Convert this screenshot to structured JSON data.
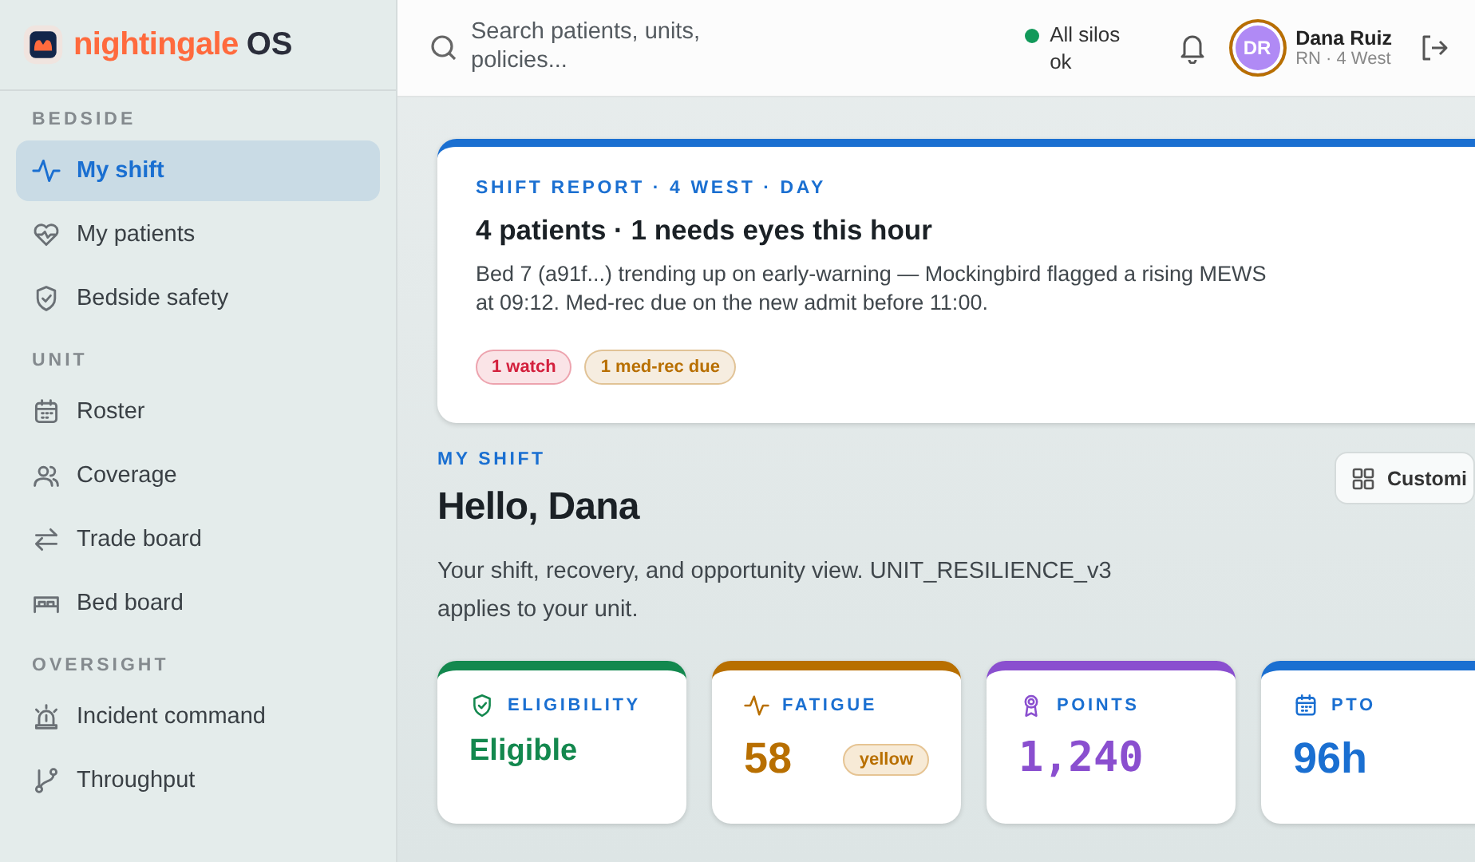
{
  "brand": {
    "name": "nightingale",
    "suffix": "OS"
  },
  "sidebar": {
    "sections": [
      {
        "title": "BEDSIDE",
        "items": [
          {
            "label": "My shift",
            "selected": true
          },
          {
            "label": "My patients",
            "selected": false
          },
          {
            "label": "Bedside safety",
            "selected": false
          }
        ]
      },
      {
        "title": "UNIT",
        "items": [
          {
            "label": "Roster",
            "selected": false
          },
          {
            "label": "Coverage",
            "selected": false
          },
          {
            "label": "Trade board",
            "selected": false
          },
          {
            "label": "Bed board",
            "selected": false
          }
        ]
      },
      {
        "title": "OVERSIGHT",
        "items": [
          {
            "label": "Incident command",
            "selected": false
          },
          {
            "label": "Throughput",
            "selected": false
          }
        ]
      }
    ]
  },
  "topbar": {
    "search": {
      "placeholder": "Search patients, units, policies..."
    },
    "status": {
      "text": "All silos ok",
      "color": "#12995a"
    },
    "user": {
      "initials": "DR",
      "name": "Dana Ruiz",
      "role": "RN · 4 West"
    }
  },
  "report": {
    "eyebrow": "SHIFT REPORT · 4 WEST · DAY",
    "title": "4 patients · 1 needs eyes this hour",
    "body": "Bed 7 (a91f...) trending up on early-warning — Mockingbird flagged a rising MEWS at 09:12. Med-rec due on the new admit before 11:00.",
    "tags": [
      {
        "label": "1 watch",
        "color": "#d3203d"
      },
      {
        "label": "1 med-rec due",
        "color": "#b86f00"
      }
    ]
  },
  "header": {
    "eyebrow": "MY SHIFT",
    "title": "Hello, Dana",
    "subtitle": "Your shift, recovery, and opportunity view. UNIT_RESILIENCE_v3 applies to your unit.",
    "button": "Customi"
  },
  "kpis": [
    {
      "label": "ELIGIBILITY",
      "value": "Eligible",
      "color": "#13884e",
      "kind": "text"
    },
    {
      "label": "FATIGUE",
      "value": "58",
      "color": "#b86f00",
      "kind": "score",
      "badge": "yellow"
    },
    {
      "label": "POINTS",
      "value": "1,240",
      "color": "#8a4fcf",
      "kind": "mono"
    },
    {
      "label": "PTO",
      "value": "96h",
      "color": "#1a6fd1",
      "kind": "score"
    }
  ]
}
